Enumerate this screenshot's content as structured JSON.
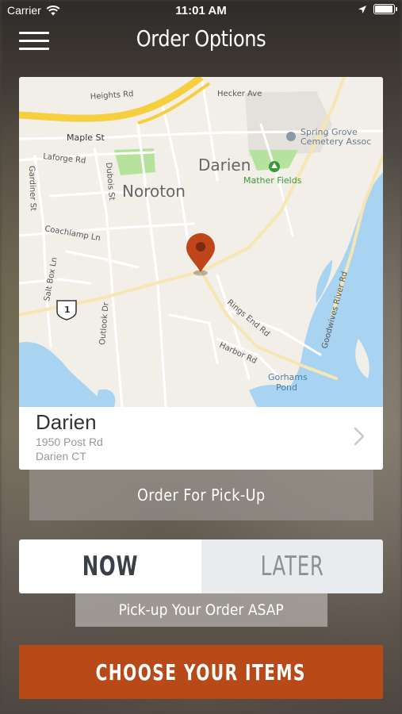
{
  "status_bar": {
    "carrier": "Carrier",
    "time": "11:01 AM",
    "battery_level": 0.95
  },
  "nav": {
    "title": "Order Options",
    "menu_icon": "hamburger-menu-icon"
  },
  "map": {
    "labels": {
      "heights_rd": "Heights Rd",
      "hecker_ave": "Hecker Ave",
      "maple_st": "Maple St",
      "laforge_rd": "Laforge Rd",
      "spring_grove_1": "Spring Grove",
      "spring_grove_2": "Cemetery Assoc",
      "darien": "Darien",
      "mather_fields": "Mather Fields",
      "noroton": "Noroton",
      "gardiner_st": "Gardiner St",
      "dubois_st": "Dubois St",
      "coachlamp_ln": "Coachlamp Ln",
      "salt_box_ln": "Salt Box Ln",
      "route_1": "1",
      "outlook_dr": "Outlook Dr",
      "rings_end_rd": "Rings End Rd",
      "harbor_rd": "Harbor Rd",
      "goodwives_river_rd": "Goodwives River Rd",
      "gorhams_pond_1": "Gorhams",
      "gorhams_pond_2": "Pond"
    },
    "colors": {
      "land": "#f2efe9",
      "water": "#a8d4f2",
      "highway": "#f6cf3f",
      "park": "#b5e39d",
      "road": "#ffffff",
      "pin": "#c0451b"
    }
  },
  "location": {
    "name": "Darien",
    "address_line1": "1950 Post Rd",
    "address_line2": "Darien CT",
    "chevron_icon": "chevron-right-icon"
  },
  "order_type_label": "Order For Pick-Up",
  "timing": {
    "now_label": "NOW",
    "later_label": "LATER",
    "selected": "now",
    "description": "Pick-up Your Order ASAP"
  },
  "cta": {
    "label": "CHOOSE YOUR ITEMS",
    "color": "#b84a19"
  }
}
